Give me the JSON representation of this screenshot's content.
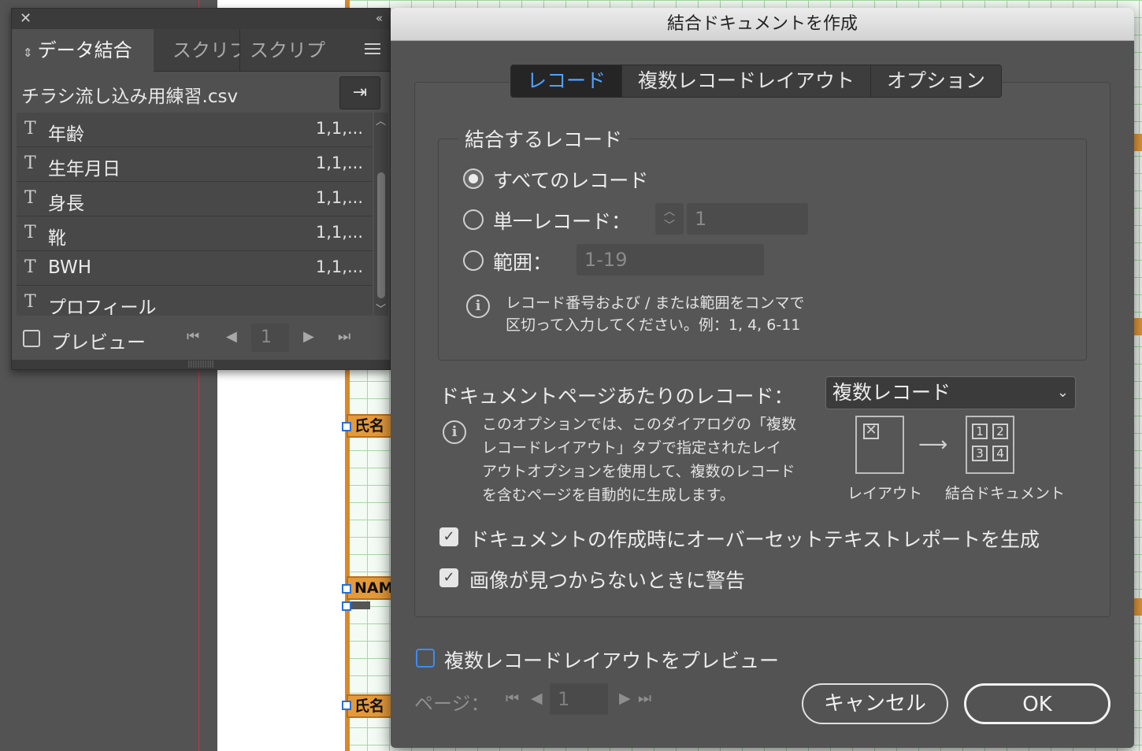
{
  "canvas": {
    "tags": [
      "氏名 <",
      "NAME",
      "氏名 <"
    ]
  },
  "panel": {
    "tabs": [
      "データ結合",
      "スクリプ",
      "スクリプ"
    ],
    "source_file": "チラシ流し込み用練習.csv",
    "fields": [
      {
        "name": "年齢",
        "value": "1,1,..."
      },
      {
        "name": "生年月日",
        "value": "1,1,..."
      },
      {
        "name": "身長",
        "value": "1,1,..."
      },
      {
        "name": "靴",
        "value": "1,1,..."
      },
      {
        "name": "BWH",
        "value": "1,1,..."
      },
      {
        "name": "プロフィール",
        "value": ""
      }
    ],
    "preview_label": "プレビュー",
    "record_number": "1"
  },
  "dialog": {
    "title": "結合ドキュメントを作成",
    "tabs": [
      "レコード",
      "複数レコードレイアウト",
      "オプション"
    ],
    "group_title": "結合するレコード",
    "radio_all": "すべてのレコード",
    "radio_single": "単一レコード：",
    "single_value": "1",
    "radio_range": "範囲：",
    "range_value": "1-19",
    "range_info_1": "レコード番号および / または範囲をコンマで",
    "range_info_2": "区切って入力してください。例：1, 4, 6-11",
    "records_per_page_label": "ドキュメントページあたりのレコード：",
    "records_per_page_value": "複数レコード",
    "option_info_1": "このオプションでは、このダイアログの「複数",
    "option_info_2": "レコードレイアウト」タブで指定されたレイ",
    "option_info_3": "アウトオプションを使用して、複数のレコード",
    "option_info_4": "を含むページを自動的に生成します。",
    "diagram_left": "レイアウト",
    "diagram_right": "結合ドキュメント",
    "diagram_nums": [
      "1",
      "2",
      "3",
      "4"
    ],
    "check_overset": "ドキュメントの作成時にオーバーセットテキストレポートを生成",
    "check_missing_images": "画像が見つからないときに警告",
    "check_preview_multi": "複数レコードレイアウトをプレビュー",
    "page_label": "ページ：",
    "page_value": "1",
    "cancel": "キャンセル",
    "ok": "OK"
  }
}
